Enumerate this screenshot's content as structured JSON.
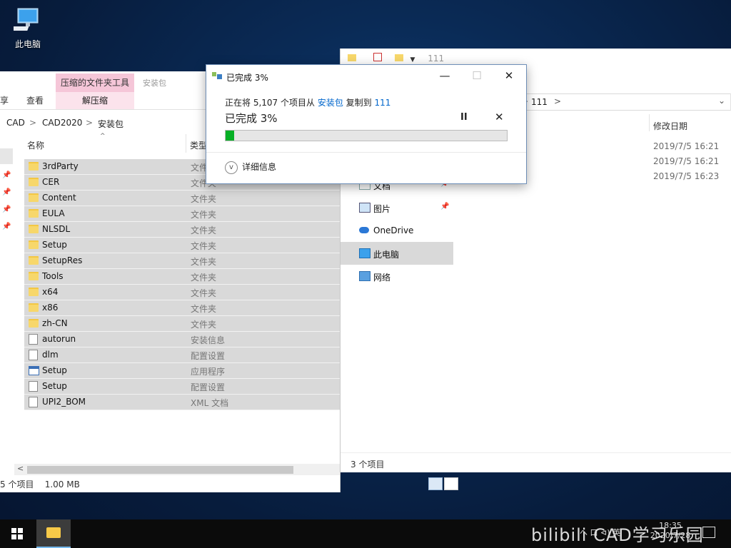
{
  "desktop": {
    "icon_label": "此电脑"
  },
  "left_window": {
    "ribbon": {
      "context_header": "压缩的文件夹工具",
      "context_name": "安装包",
      "tab_share": "享",
      "tab_view": "查看",
      "tab_extract": "解压缩"
    },
    "breadcrumb": [
      "CAD",
      "CAD2020",
      "安装包"
    ],
    "breadcrumb_sep": ">",
    "columns": {
      "name": "名称",
      "type": "类型"
    },
    "files": [
      {
        "name": "3rdParty",
        "type": "文件夹",
        "icon": "folder-icon"
      },
      {
        "name": "CER",
        "type": "文件夹",
        "icon": "folder-icon"
      },
      {
        "name": "Content",
        "type": "文件夹",
        "icon": "folder-icon"
      },
      {
        "name": "EULA",
        "type": "文件夹",
        "icon": "folder-icon"
      },
      {
        "name": "NLSDL",
        "type": "文件夹",
        "icon": "folder-icon"
      },
      {
        "name": "Setup",
        "type": "文件夹",
        "icon": "folder-icon"
      },
      {
        "name": "SetupRes",
        "type": "文件夹",
        "icon": "folder-icon"
      },
      {
        "name": "Tools",
        "type": "文件夹",
        "icon": "folder-icon"
      },
      {
        "name": "x64",
        "type": "文件夹",
        "icon": "folder-icon"
      },
      {
        "name": "x86",
        "type": "文件夹",
        "icon": "folder-icon"
      },
      {
        "name": "zh-CN",
        "type": "文件夹",
        "icon": "folder-icon"
      },
      {
        "name": "autorun",
        "type": "安装信息",
        "icon": "settings-file-icon"
      },
      {
        "name": "dlm",
        "type": "配置设置",
        "icon": "settings-file-icon"
      },
      {
        "name": "Setup",
        "type": "应用程序",
        "icon": "app-icon"
      },
      {
        "name": "Setup",
        "type": "配置设置",
        "icon": "settings-file-icon"
      },
      {
        "name": "UPI2_BOM",
        "type": "XML 文档",
        "icon": "xml-file-icon"
      }
    ],
    "status": {
      "count": "5 个项目",
      "size": "1.00 MB"
    }
  },
  "right_window": {
    "address_tail": ":)",
    "address_folder": "111",
    "quick_title": "111",
    "column_date": "修改日期",
    "dates": [
      "2019/7/5 16:21",
      "2019/7/5 16:21",
      "2019/7/5 16:23"
    ],
    "nav": [
      {
        "label": "文档",
        "icon": "documents-icon",
        "pinned": true
      },
      {
        "label": "图片",
        "icon": "pictures-icon",
        "pinned": true
      },
      {
        "label": "OneDrive",
        "icon": "onedrive-icon",
        "pinned": false
      },
      {
        "label": "此电脑",
        "icon": "this-pc-icon",
        "pinned": false,
        "selected": true
      },
      {
        "label": "网络",
        "icon": "network-icon",
        "pinned": false
      }
    ],
    "status": "3 个项目"
  },
  "copy_dialog": {
    "title": "已完成 3%",
    "line_prefix": "正在将 5,107 个项目从",
    "source": "安装包",
    "line_mid": "复制到",
    "dest": "111",
    "big_status": "已完成 3%",
    "progress_percent": 3,
    "more_info": "详细信息",
    "pause_symbol": "II",
    "cancel_symbol": "✕"
  },
  "taskbar": {
    "tray_text": "へ 口 ⊲) 英",
    "time": "18:35",
    "date": "2020/7/28",
    "watermark": "bilibili CAD学习乐园"
  },
  "colors": {
    "progress_fill": "#06b025",
    "accent": "#0066cc",
    "ctx_tab": "#f5c6d8"
  }
}
